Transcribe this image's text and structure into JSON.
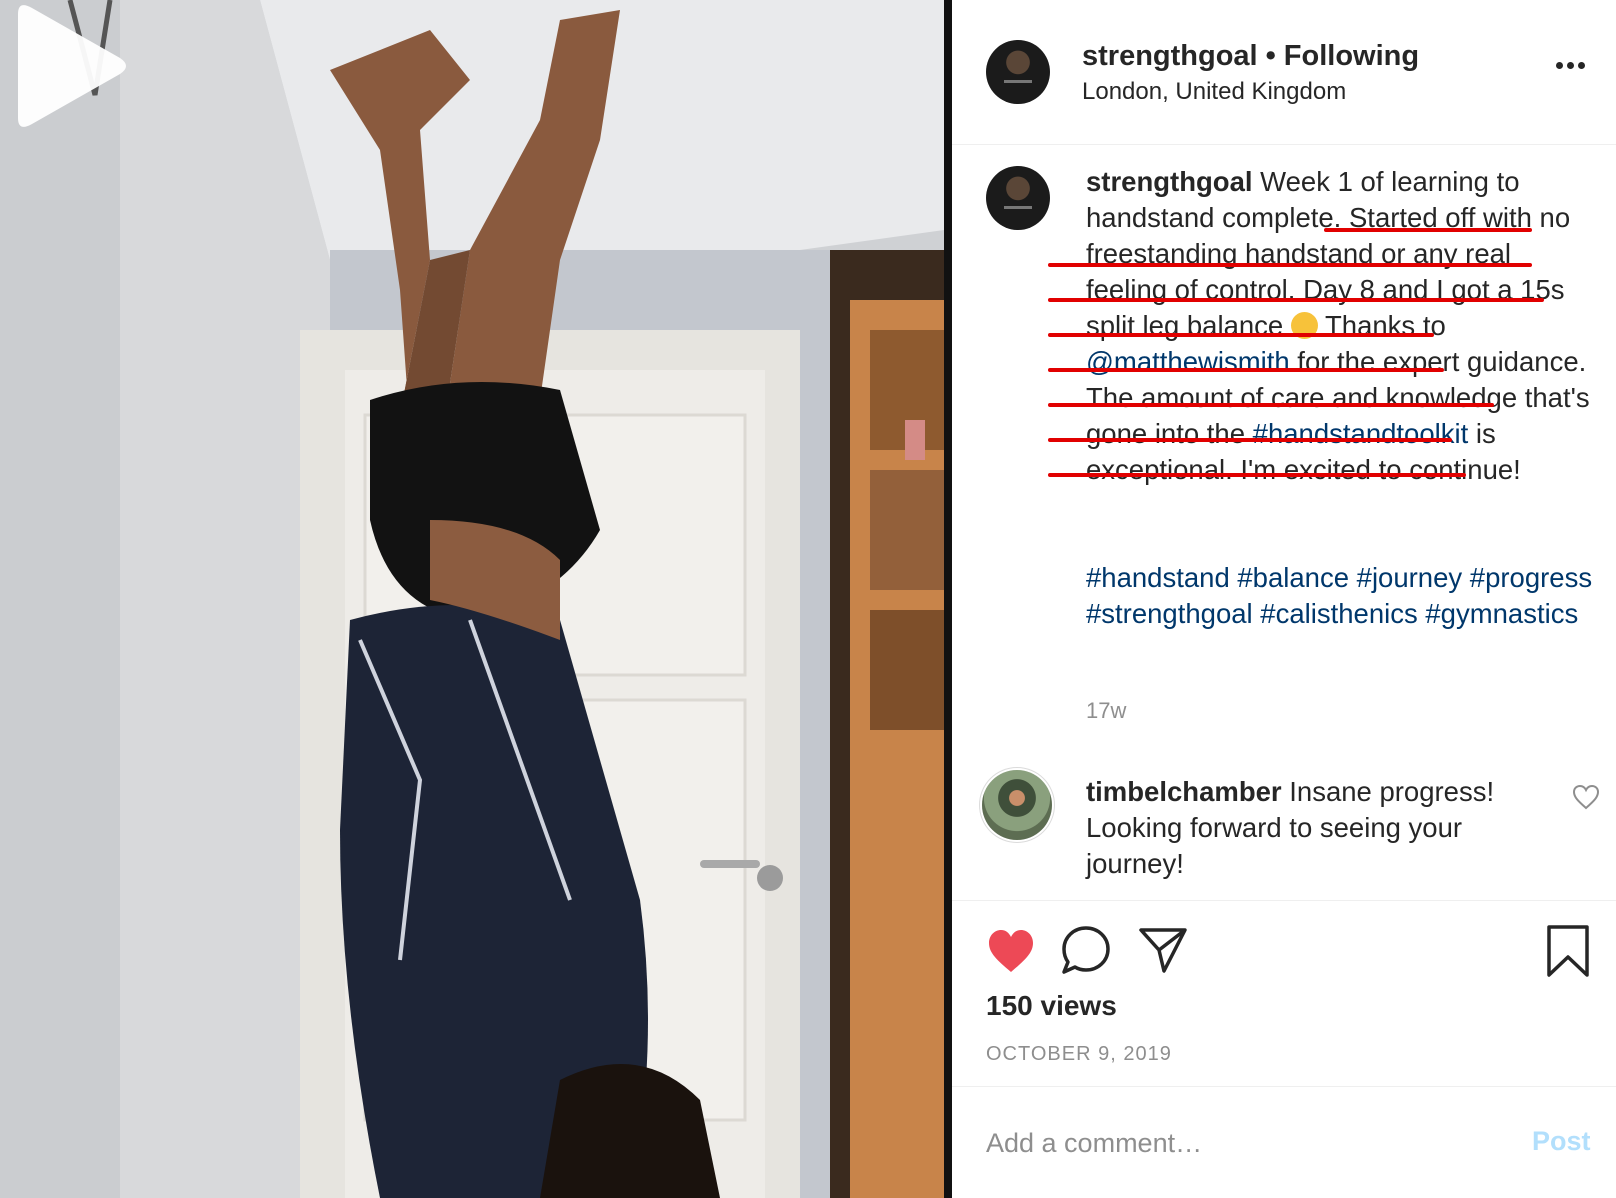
{
  "post": {
    "username": "strengthgoal",
    "separator": "•",
    "follow_status": "Following",
    "location": "London, United Kingdom",
    "more_icon": "more-options-icon"
  },
  "caption": {
    "username": "strengthgoal",
    "text_1": " Week 1 of learning to handstand complete. Started off with no freestanding handstand or any real feeling of control. Day 8 and I got a 15s split leg balance ",
    "emoji": "smiling-face-emoji",
    "text_2": "  Thanks to ",
    "mention": "@matthewismith",
    "text_3": " for the expert guidance. The amount of care and knowledge that's gone into the ",
    "hashtag_inline": "#handstandtoolkit",
    "text_4": " is exceptional. I'm excited to continue!",
    "hashtags": [
      "#handstand",
      "#balance",
      "#journey",
      "#progress",
      "#strengthgoal",
      "#calisthenics",
      "#gymnastics"
    ],
    "time_ago": "17w",
    "underline_color": "#e10000"
  },
  "comment": {
    "username": "timbelchamber",
    "text": " Insane progress! Looking forward to seeing your journey!"
  },
  "actions": {
    "like_icon": "heart-filled-icon",
    "comment_icon": "comment-bubble-icon",
    "share_icon": "paper-plane-icon",
    "save_icon": "bookmark-icon",
    "like_color": "#ed4956",
    "views": "150 views",
    "date": "OCTOBER 9, 2019"
  },
  "add_comment": {
    "placeholder": "Add a comment…",
    "post_label": "Post",
    "post_color": "#b2dffc"
  },
  "media": {
    "play_icon": "play-icon"
  }
}
